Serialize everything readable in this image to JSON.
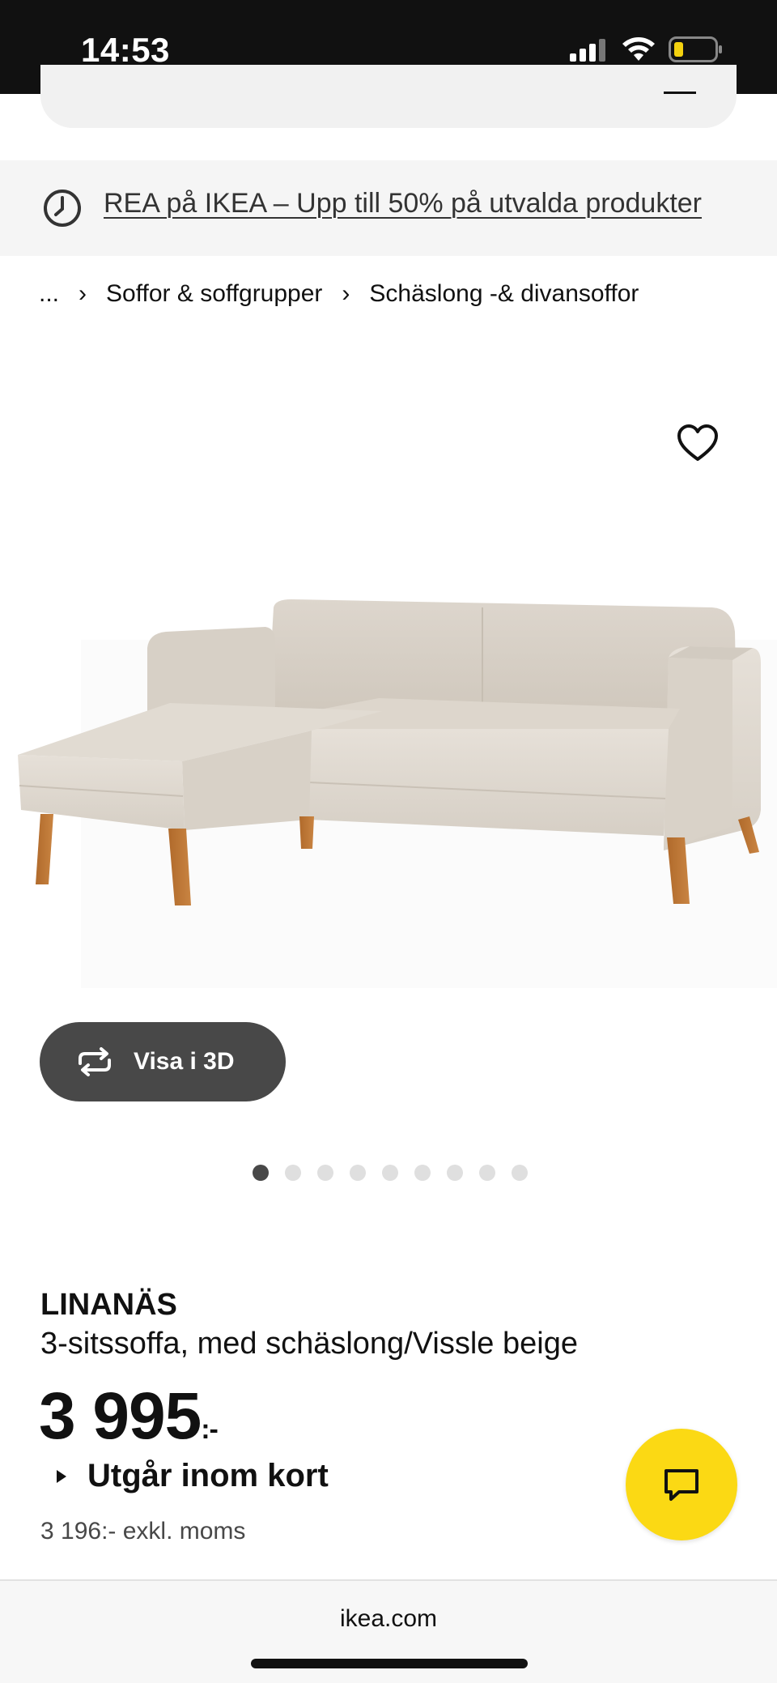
{
  "status_bar": {
    "time": "14:53",
    "icons": [
      "signal-icon",
      "wifi-icon",
      "battery-icon"
    ],
    "battery_color": "#f4d20f"
  },
  "promo": {
    "icon": "clock-icon",
    "text": "REA på IKEA – Upp till 50% på utvalda produkter"
  },
  "breadcrumb": {
    "items": [
      "...",
      "Soffor & soffgrupper",
      "Schäslong -& divansoffor"
    ],
    "separator": "›"
  },
  "gallery": {
    "favorite_icon": "heart-icon",
    "view3d_label": "Visa i 3D",
    "view3d_icon": "rotate-icon",
    "dot_count": 9,
    "active_index": 0
  },
  "product": {
    "name": "LINANÄS",
    "description": "3-sitssoffa, med schäslong/Vissle beige",
    "price": "3 995",
    "price_suffix": ":-",
    "stock_status": "Utgår inom kort",
    "excl_vat": "3 196:- exkl. moms"
  },
  "chat": {
    "icon": "chat-icon",
    "color": "#fbd914"
  },
  "browser": {
    "domain": "ikea.com"
  }
}
